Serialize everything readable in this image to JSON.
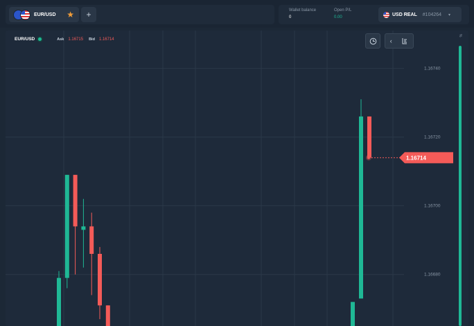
{
  "header": {
    "pair_tab": {
      "label": "EUR/USD",
      "flags": [
        "eu-flag",
        "us-flag"
      ],
      "star_icon": "star-icon"
    },
    "add_tab_label": "+",
    "wallet_balance": {
      "label": "Wallet balance",
      "value": "0"
    },
    "open_pl": {
      "label": "Open P/L",
      "value": "0.00"
    },
    "account": {
      "type": "USD REAL",
      "id": "#104264",
      "chevron": "▾"
    }
  },
  "chart": {
    "instrument": "EUR/USD",
    "ask_label": "Ask",
    "ask_value": "1.16715",
    "bid_label": "Bid",
    "bid_value": "1.16714",
    "current_price": "1.16714",
    "tools": {
      "clock": "clock-icon",
      "collapse": "chevron-left-icon",
      "indicators": "indicators-icon"
    },
    "meter_label": "%"
  },
  "chart_data": {
    "type": "candlestick",
    "y_ticks": [
      "1.16740",
      "1.16720",
      "1.16700",
      "1.16680"
    ],
    "ylim": [
      1.16665,
      1.16749
    ],
    "current_price": 1.16714,
    "colors": {
      "up": "#1fb895",
      "down": "#f45b58",
      "grid": "#2b3848",
      "price_line": "#f45b58"
    },
    "candles": [
      {
        "dir": "up",
        "open": 1.16665,
        "close": 1.16679,
        "high": 1.16681,
        "low": 1.16665
      },
      {
        "dir": "up",
        "open": 1.16679,
        "close": 1.16709,
        "high": 1.16709,
        "low": 1.16676
      },
      {
        "dir": "down",
        "open": 1.16709,
        "close": 1.16694,
        "high": 1.16709,
        "low": 1.1668
      },
      {
        "dir": "up",
        "open": 1.16693,
        "close": 1.16694,
        "high": 1.16702,
        "low": 1.16682
      },
      {
        "dir": "down",
        "open": 1.16694,
        "close": 1.16686,
        "high": 1.16698,
        "low": 1.16674
      },
      {
        "dir": "down",
        "open": 1.16686,
        "close": 1.16671,
        "high": 1.16688,
        "low": 1.16667
      },
      {
        "dir": "down",
        "open": 1.16671,
        "close": 1.16665,
        "high": 1.16671,
        "low": 1.16665
      },
      {
        "dir": "up",
        "open": 1.16665,
        "close": 1.16672,
        "high": 1.16672,
        "low": 1.16665
      },
      {
        "dir": "up",
        "open": 1.16673,
        "close": 1.16726,
        "high": 1.16731,
        "low": 1.16673
      },
      {
        "dir": "down",
        "open": 1.16726,
        "close": 1.16714,
        "high": 1.16726,
        "low": 1.16714
      }
    ]
  }
}
